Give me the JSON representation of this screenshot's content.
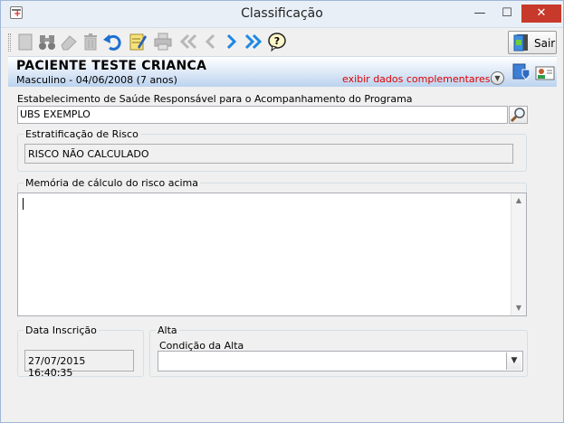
{
  "window": {
    "title": "Classificação",
    "controls": {
      "minimize": "—",
      "maximize": "☐",
      "close": "✕"
    }
  },
  "toolbar": {
    "buttons": [
      {
        "name": "new-record-button",
        "icon": "blank-page-icon"
      },
      {
        "name": "find-button",
        "icon": "binoculars-icon"
      },
      {
        "name": "erase-button",
        "icon": "eraser-icon"
      },
      {
        "name": "delete-button",
        "icon": "trash-icon"
      },
      {
        "name": "undo-button",
        "icon": "undo-arrow-icon"
      },
      {
        "name": "edit-button",
        "icon": "pencil-notepad-icon"
      },
      {
        "name": "print-button",
        "icon": "printer-icon"
      },
      {
        "name": "first-record-button",
        "icon": "double-chevron-left-icon"
      },
      {
        "name": "previous-record-button",
        "icon": "chevron-left-icon"
      },
      {
        "name": "next-record-button",
        "icon": "chevron-right-icon"
      },
      {
        "name": "last-record-button",
        "icon": "double-chevron-right-icon"
      },
      {
        "name": "help-button",
        "icon": "question-bubble-icon"
      }
    ],
    "exit_label": "Sair"
  },
  "patient": {
    "name": "PACIENTE TESTE CRIANCA",
    "info": "Masculino - 04/06/2008 (7 anos)",
    "extra_link": "exibir dados complementares..."
  },
  "form": {
    "establishment_label": "Estabelecimento de Saúde Responsável para o Acompanhamento do Programa",
    "establishment_value": "UBS EXEMPLO",
    "risk_group_title": "Estratificação de Risco",
    "risk_value": "RISCO NÃO CALCULADO",
    "memory_group_title": "Memória de cálculo do risco acima",
    "memory_value": "",
    "enrollment_group_title": "Data Inscrição",
    "enrollment_value": "27/07/2015 16:40:35",
    "discharge_group_title": "Alta",
    "discharge_condition_label": "Condição da Alta",
    "discharge_condition_value": ""
  },
  "colors": {
    "close_button": "#c7392a",
    "band_gradient_end": "#bcd3ef",
    "extra_link": "#e00000",
    "navigation_arrows": "#1e88e5"
  }
}
